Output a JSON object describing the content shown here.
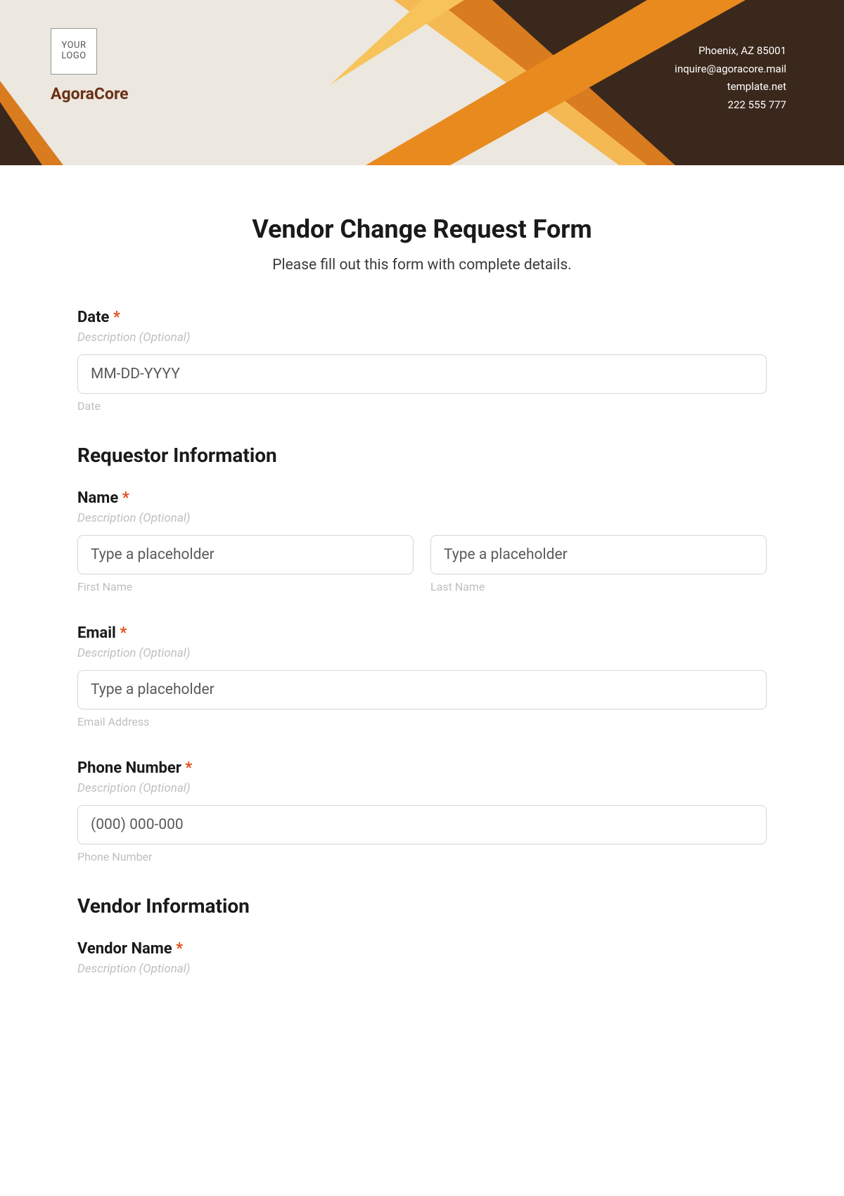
{
  "header": {
    "logo_text": "YOUR LOGO",
    "brand": "AgoraCore",
    "contact": {
      "line1": "Phoenix, AZ 85001",
      "line2": "inquire@agoracore.mail",
      "line3": "template.net",
      "line4": "222 555 777"
    }
  },
  "form": {
    "title": "Vendor Change Request Form",
    "subtitle": "Please fill out this form with complete details.",
    "desc_optional": "Description (Optional)",
    "required_mark": "*",
    "date": {
      "label": "Date",
      "placeholder": "MM-DD-YYYY",
      "sublabel": "Date"
    },
    "section_requestor": "Requestor Information",
    "name": {
      "label": "Name",
      "placeholder_first": "Type a placeholder",
      "placeholder_last": "Type a placeholder",
      "sublabel_first": "First Name",
      "sublabel_last": "Last Name"
    },
    "email": {
      "label": "Email",
      "placeholder": "Type a placeholder",
      "sublabel": "Email Address"
    },
    "phone": {
      "label": "Phone Number",
      "placeholder": "(000) 000-000",
      "sublabel": "Phone Number"
    },
    "section_vendor": "Vendor Information",
    "vendor_name": {
      "label": "Vendor Name"
    }
  }
}
